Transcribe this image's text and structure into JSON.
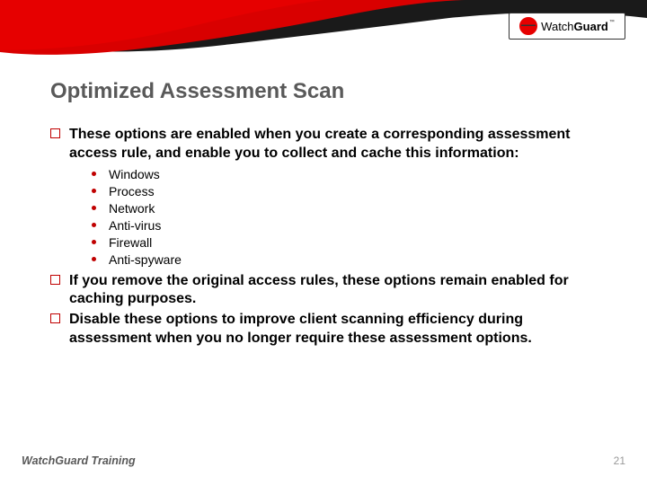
{
  "brand": {
    "watch": "Watch",
    "guard": "Guard",
    "tm": "™"
  },
  "title": "Optimized Assessment Scan",
  "bullets": [
    {
      "text": "These options are enabled when you create a corresponding assessment access rule, and enable you to collect and cache this information:",
      "sub": [
        "Windows",
        "Process",
        "Network",
        "Anti-virus",
        "Firewall",
        "Anti-spyware"
      ]
    },
    {
      "text": "If you remove the original access rules, these options remain enabled for caching purposes.",
      "sub": []
    },
    {
      "text": "Disable these options to improve client scanning efficiency during assessment when you no longer require these assessment options.",
      "sub": []
    }
  ],
  "footer": {
    "left": "WatchGuard Training",
    "right": "21"
  }
}
